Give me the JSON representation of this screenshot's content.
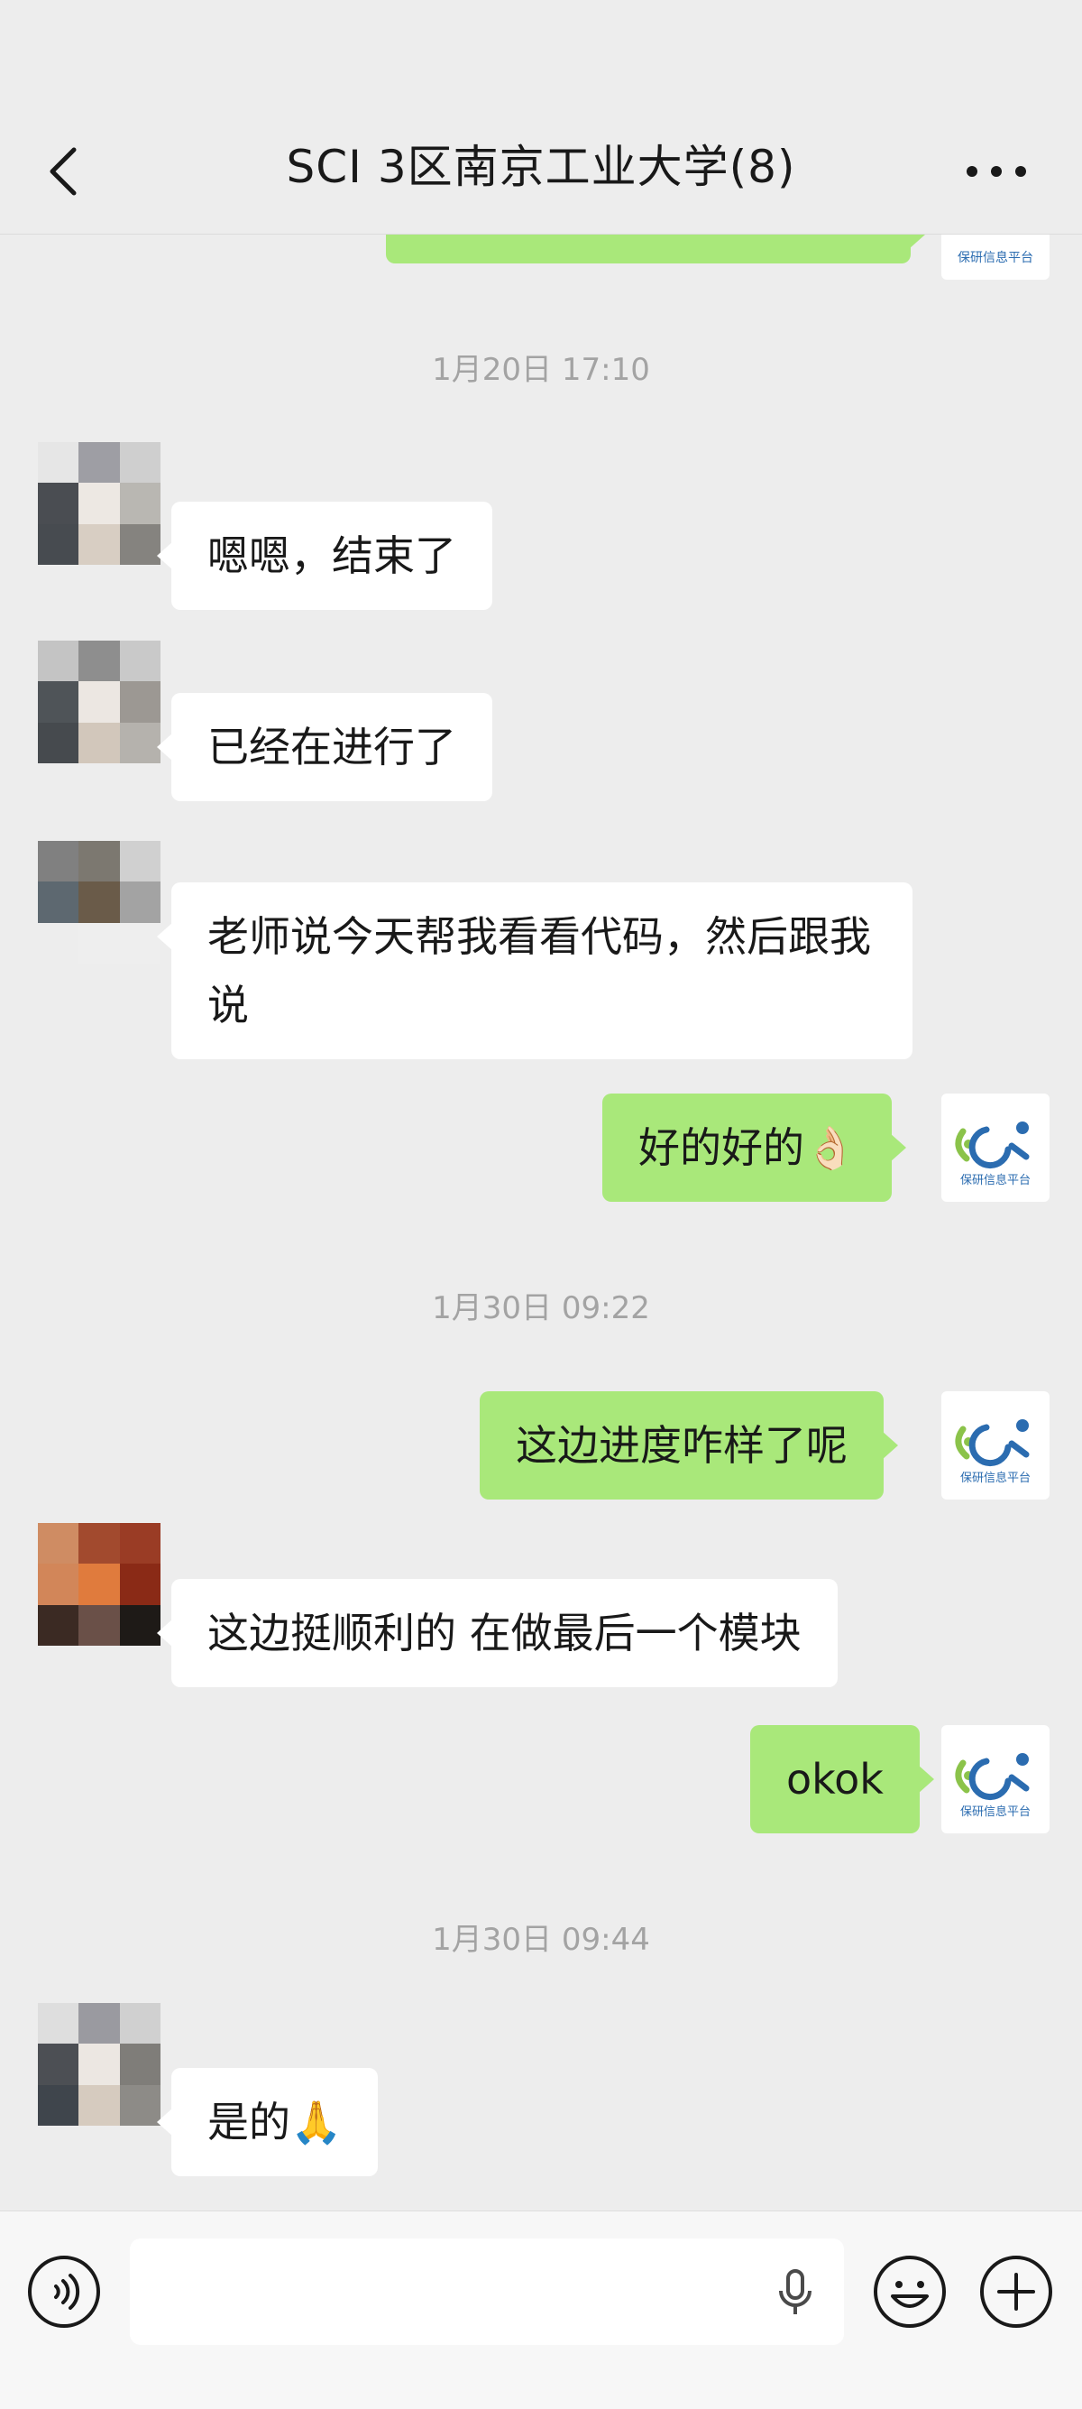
{
  "header": {
    "title": "SCI 3区南京工业大学(8)"
  },
  "colors": {
    "background": "#ededed",
    "my_bubble": "#a9e87a",
    "their_bubble": "#ffffff",
    "timestamp": "#a3a3a3",
    "logo_green": "#8bc34a",
    "logo_blue": "#2b6cb0"
  },
  "avatar_logo_text": "保研信息平台",
  "messages": [
    {
      "type": "time",
      "text": "1月20日 17:10"
    },
    {
      "type": "left",
      "text": "嗯嗯，结束了"
    },
    {
      "type": "left",
      "text": "已经在进行了"
    },
    {
      "type": "left",
      "text": "老师说今天帮我看看代码，然后跟我说"
    },
    {
      "type": "right",
      "text": "好的好的👌🏻"
    },
    {
      "type": "time",
      "text": "1月30日 09:22"
    },
    {
      "type": "right",
      "text": "这边进度咋样了呢"
    },
    {
      "type": "left",
      "text": "这边挺顺利的 在做最后一个模块"
    },
    {
      "type": "right",
      "text": "okok"
    },
    {
      "type": "time",
      "text": "1月30日 09:44"
    },
    {
      "type": "left",
      "text": "是的🙏"
    }
  ],
  "inputbar": {
    "placeholder": "",
    "icons": [
      "voice-icon",
      "microphone-icon",
      "emoji-icon",
      "plus-icon"
    ]
  }
}
